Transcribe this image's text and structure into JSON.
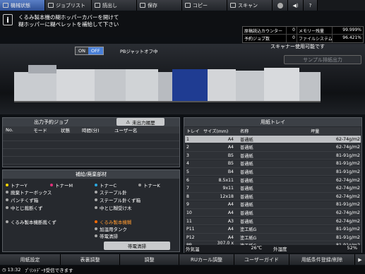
{
  "top_tabs": [
    "機械状態",
    "ジョブリスト",
    "読出し",
    "保存",
    "コピー",
    "スキャン"
  ],
  "message": {
    "line1": "くるみ製本機の糊ホッパーカバーを開けて",
    "line2": "糊ホッパーに糊ペレットを補給して下さい"
  },
  "counters": {
    "row1": {
      "label": "原稿読込カウンター",
      "value": "0",
      "mem_label": "メモリー残量",
      "mem_value": "99.999%"
    },
    "row2": {
      "label": "予約ジョブ数",
      "value": "0",
      "mem_label": "ファイルシステム残量",
      "mem_value": "96.421%"
    }
  },
  "onoff": {
    "on": "ON",
    "off": "OFF",
    "pb": "PBジャットオフ中"
  },
  "scanner_status": "スキャナー使用可能です",
  "sample_button": "サンプル排紙出力",
  "jobs": {
    "title": "出力予約ジョブ",
    "history_button": "未出力履歴",
    "columns": [
      "No.",
      "モード",
      "状態",
      "時間(分)",
      "ユーザー名"
    ]
  },
  "supplies": {
    "title": "補給/廃棄部材",
    "items": [
      {
        "label": "トナーY",
        "color": "#f5d400"
      },
      {
        "label": "トナーM",
        "color": "#e0307a"
      },
      {
        "label": "トナーC",
        "color": "#2aa7e0"
      },
      {
        "label": "トナーK",
        "color": "#111111"
      },
      {
        "label": "廃棄トナーボックス"
      },
      {
        "label": "ステープル針"
      },
      {
        "label": "パンチくず箱"
      },
      {
        "label": "ステープル針くず箱"
      },
      {
        "label": "中とじ裁断くず"
      },
      {
        "label": "中とじ糊受け木"
      },
      {
        "label": "くるみ製本機断裁くず"
      },
      {
        "label": "くるみ製本機糊",
        "color": "#ff6a00"
      },
      {
        "label": "加湿用タンク"
      },
      {
        "label": "帯電清掃"
      }
    ],
    "clean_button": "帯電清掃"
  },
  "trays": {
    "title": "用紙トレイ",
    "columns": [
      "トレイ",
      "サイズ(mm)",
      "名称",
      "坪量"
    ],
    "rows": [
      {
        "tray": "1",
        "size": "A4",
        "name": "普通紙",
        "weight": "62-74g/m2"
      },
      {
        "tray": "2",
        "size": "A4",
        "name": "普通紙",
        "weight": "62-74g/m2"
      },
      {
        "tray": "3",
        "size": "B5",
        "name": "普通紙",
        "weight": "81-91g/m2"
      },
      {
        "tray": "4",
        "size": "B5",
        "name": "普通紙",
        "weight": "81-91g/m2"
      },
      {
        "tray": "5",
        "size": "B4",
        "name": "普通紙",
        "weight": "81-91g/m2"
      },
      {
        "tray": "6",
        "size": "8.5x11",
        "name": "普通紙",
        "weight": "62-74g/m2"
      },
      {
        "tray": "7",
        "size": "9x11",
        "name": "普通紙",
        "weight": "62-74g/m2"
      },
      {
        "tray": "8",
        "size": "12x18",
        "name": "普通紙",
        "weight": "62-74g/m2"
      },
      {
        "tray": "9",
        "size": "A4",
        "name": "普通紙",
        "weight": "81-91g/m2"
      },
      {
        "tray": "10",
        "size": "A4",
        "name": "普通紙",
        "weight": "62-74g/m2"
      },
      {
        "tray": "11",
        "size": "A3",
        "name": "普通紙",
        "weight": "62-74g/m2"
      },
      {
        "tray": "P11",
        "size": "A4",
        "name": "塗工紙G",
        "weight": "81-91g/m2"
      },
      {
        "tray": "P12",
        "size": "A4",
        "name": "塗工紙G",
        "weight": "81-91g/m2"
      },
      {
        "tray": "PB",
        "size": "307.0 x 472.0",
        "name": "塗工紙G",
        "weight": "81-91g/m2"
      }
    ],
    "outside_temp_label": "外気温",
    "outside_temp": "26℃",
    "humidity_label": "外湿度",
    "humidity": "52%"
  },
  "bottom_buttons": [
    "用紙設定",
    "表裏調整",
    "調整",
    "RUカール調整",
    "ユーザーガイド",
    "用紙条件登録/削除"
  ],
  "status": {
    "time": "13:32",
    "text": "ﾌﾟﾘﾝﾄﾃﾞｰﾀ受信できます"
  }
}
